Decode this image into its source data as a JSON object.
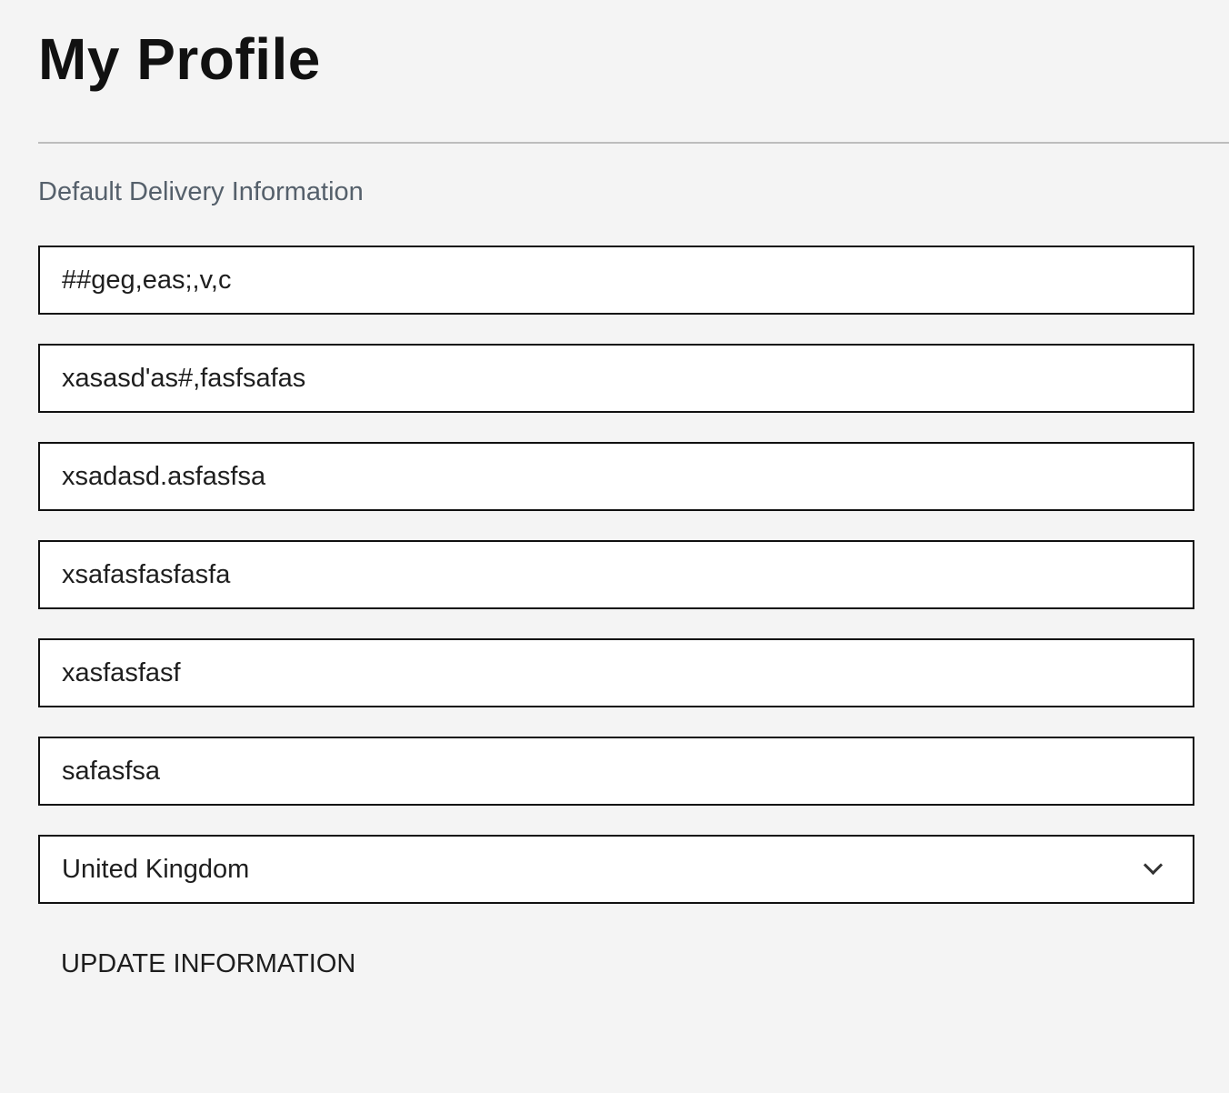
{
  "page": {
    "title": "My Profile",
    "section_title": "Default Delivery Information"
  },
  "fields": [
    {
      "value": "##geg,eas;,v,c"
    },
    {
      "value": "xasasd'as#,fasfsafas"
    },
    {
      "value": "xsadasd.asfasfsa"
    },
    {
      "value": "xsafasfasfasfa"
    },
    {
      "value": "xasfasfasf"
    },
    {
      "value": "safasfsa"
    }
  ],
  "country": {
    "selected": "United Kingdom",
    "icon": "chevron-down-icon"
  },
  "actions": {
    "update_label": "UPDATE INFORMATION"
  }
}
